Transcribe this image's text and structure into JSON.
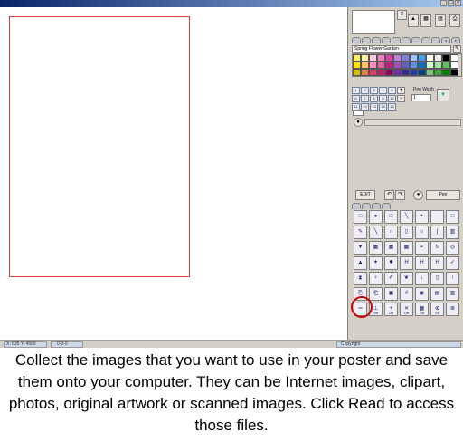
{
  "status": {
    "coords": "X: 635  Y: 4509",
    "zoom": "0-0-0",
    "copyright": "Copyright"
  },
  "palette": {
    "name": "Spring Flower Garden",
    "colors": [
      "#fff066",
      "#f8f0a0",
      "#ffd0e0",
      "#f080c0",
      "#e040a0",
      "#c080e0",
      "#8080e0",
      "#a0c0ff",
      "#40a0f0",
      "#ffffff",
      "#e8e8e8",
      "#000000",
      "#ffffff",
      "#ffe000",
      "#ffc060",
      "#ff90c0",
      "#e060a0",
      "#c02080",
      "#a050c0",
      "#6060c0",
      "#6090e0",
      "#1070c0",
      "#d0ffd0",
      "#a0e0a0",
      "#60c060",
      "#ffffff",
      "#d0c000",
      "#e08040",
      "#e04060",
      "#c02060",
      "#900060",
      "#7030a0",
      "#303090",
      "#2040a0",
      "#004080",
      "#80c080",
      "#40a040",
      "#008000",
      "#000000"
    ]
  },
  "pens": [
    "1",
    "2",
    "3",
    "4",
    "5",
    "6",
    "7",
    "8",
    "9",
    "10",
    "11",
    "12",
    "13",
    "14",
    "15"
  ],
  "pen_width": {
    "label": "Pen Width",
    "value": "1"
  },
  "edit_label": "EDIT",
  "pen_label": "Pen",
  "tools": [
    {
      "icon": "select-icon",
      "glyph": "□",
      "label": ""
    },
    {
      "icon": "paint-icon",
      "glyph": "●",
      "label": ""
    },
    {
      "icon": "fill-icon",
      "glyph": "□",
      "label": ""
    },
    {
      "icon": "line-icon",
      "glyph": "╲",
      "label": ""
    },
    {
      "icon": "point-icon",
      "glyph": "•",
      "label": ""
    },
    {
      "icon": "blank-icon",
      "glyph": "",
      "label": ""
    },
    {
      "icon": "rectangle-icon",
      "glyph": "□",
      "label": ""
    },
    {
      "icon": "pencil-icon",
      "glyph": "✎",
      "label": ""
    },
    {
      "icon": "diagonal-line-icon",
      "glyph": "╲",
      "label": ""
    },
    {
      "icon": "arc-icon",
      "glyph": "∩",
      "label": ""
    },
    {
      "icon": "rect-outline-icon",
      "glyph": "▯",
      "label": ""
    },
    {
      "icon": "ellipse-icon",
      "glyph": "○",
      "label": ""
    },
    {
      "icon": "curve-icon",
      "glyph": "∫",
      "label": ""
    },
    {
      "icon": "column-icon",
      "glyph": "▥",
      "label": ""
    },
    {
      "icon": "funnel-icon",
      "glyph": "▼",
      "label": ""
    },
    {
      "icon": "grid-small-icon",
      "glyph": "▦",
      "label": ""
    },
    {
      "icon": "grid-medium-icon",
      "glyph": "▦",
      "label": ""
    },
    {
      "icon": "grid-large-icon",
      "glyph": "▦",
      "label": ""
    },
    {
      "icon": "move-icon",
      "glyph": "▪",
      "label": ""
    },
    {
      "icon": "rotate-icon",
      "glyph": "↻",
      "label": ""
    },
    {
      "icon": "circle-target-icon",
      "glyph": "◎",
      "label": ""
    },
    {
      "icon": "stamp-icon",
      "glyph": "▲",
      "label": ""
    },
    {
      "icon": "sparkle-icon",
      "glyph": "✦",
      "label": ""
    },
    {
      "icon": "star-icon",
      "glyph": "✸",
      "label": ""
    },
    {
      "icon": "h-blue-icon",
      "glyph": "H",
      "label": ""
    },
    {
      "icon": "h-teal-icon",
      "glyph": "H",
      "label": ""
    },
    {
      "icon": "h-purple-icon",
      "glyph": "H",
      "label": ""
    },
    {
      "icon": "check-icon",
      "glyph": "✓",
      "label": ""
    },
    {
      "icon": "hourglass-icon",
      "glyph": "⧗",
      "label": ""
    },
    {
      "icon": "trophy-icon",
      "glyph": "♆",
      "label": ""
    },
    {
      "icon": "brush-icon",
      "glyph": "✐",
      "label": ""
    },
    {
      "icon": "leaf-icon",
      "glyph": "❦",
      "label": ""
    },
    {
      "icon": "download-icon",
      "glyph": "↓",
      "label": ""
    },
    {
      "icon": "bottle-icon",
      "glyph": "▯",
      "label": ""
    },
    {
      "icon": "upload-icon",
      "glyph": "↑",
      "label": ""
    },
    {
      "icon": "read-file-icon",
      "glyph": "⎘",
      "label": ""
    },
    {
      "icon": "save-file-icon",
      "glyph": "⎗",
      "label": ""
    },
    {
      "icon": "frame-icon",
      "glyph": "▣",
      "label": ""
    },
    {
      "icon": "hash-icon",
      "glyph": "#",
      "label": ""
    },
    {
      "icon": "eye-icon",
      "glyph": "◉",
      "label": ""
    },
    {
      "icon": "lock-icon",
      "glyph": "▤",
      "label": ""
    },
    {
      "icon": "bucket-icon",
      "glyph": "▥",
      "label": ""
    },
    {
      "icon": "ruler-icon",
      "glyph": "═",
      "label": ""
    },
    {
      "icon": "mark-off-icon",
      "glyph": "⊥",
      "label": "Off"
    },
    {
      "icon": "plus-off-icon",
      "glyph": "+",
      "label": "Off"
    },
    {
      "icon": "cross-off-icon",
      "glyph": "✕",
      "label": "Off"
    },
    {
      "icon": "grid-off-icon",
      "glyph": "▦",
      "label": "Off"
    },
    {
      "icon": "link-off-icon",
      "glyph": "⊕",
      "label": "Off"
    },
    {
      "icon": "layers-icon",
      "glyph": "≣",
      "label": ""
    }
  ],
  "caption": "Collect the images that you want to use in your poster and save them onto your computer. They can be Internet images, clipart, photos, original artwork or scanned images. Click Read to access those files."
}
